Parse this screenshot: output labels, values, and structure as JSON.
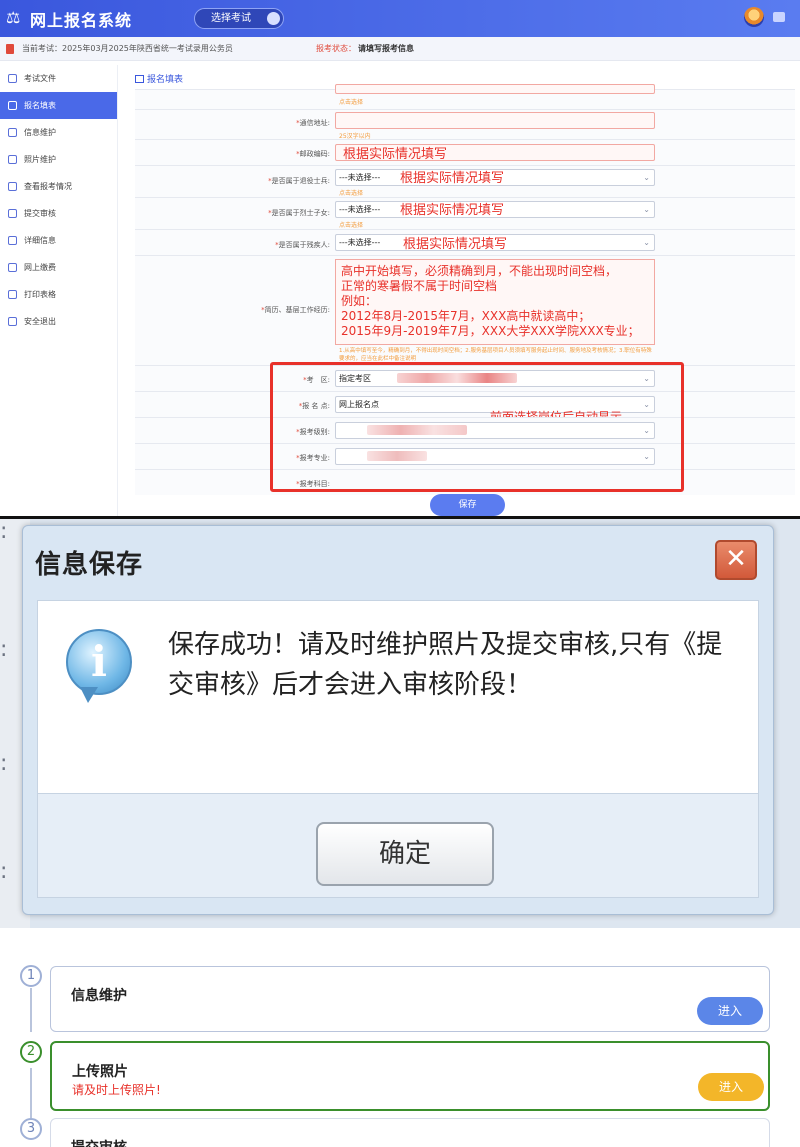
{
  "header": {
    "app_title": "网上报名系统",
    "exam_button": "选择考试",
    "current_exam_label": "当前考试：",
    "current_exam": "2025年03月2025年陕西省统一考试录用公务员",
    "status_label": "报考状态：",
    "status_value": "请填写报考信息"
  },
  "sidebar": {
    "items": [
      {
        "label": "考试文件"
      },
      {
        "label": "报名填表"
      },
      {
        "label": "信息维护"
      },
      {
        "label": "照片维护"
      },
      {
        "label": "查看报考情况"
      },
      {
        "label": "提交审核"
      },
      {
        "label": "详细信息"
      },
      {
        "label": "网上缴费"
      },
      {
        "label": "打印表格"
      },
      {
        "label": "安全退出"
      }
    ]
  },
  "form": {
    "title": "报名填表",
    "click_select_hint": "点击选择",
    "address_label": "通信地址:",
    "address_hint": "25汉字以内",
    "postcode_label": "邮政编码:",
    "veteran_label": "是否属于退役士兵:",
    "martyr_label": "是否属于烈士子女:",
    "disabled_label": "是否属于残疾人:",
    "not_selected": "---未选择---",
    "fill_note": "根据实际情况填写",
    "resume_label": "简历、基层工作经历:",
    "resume_lines": [
      "高中开始填写，必须精确到月，不能出现时间空档，",
      "正常的寒暑假不属于时间空档",
      "例如：",
      "2012年8月-2015年7月，XXX高中就读高中；",
      "2015年9月-2019年7月，XXX大学XXX学院XXX专业；"
    ],
    "resume_tip": "1.从高中填写至今，精确到月，不得出现时间空档；2.服务基层项目人员须填写服务起止时间、服务地及考核情况；3.职位有特殊要求的，应当在此栏中备注说明",
    "exam_area_label": "考　区:",
    "exam_area_value": "指定考区",
    "site_label": "报 名 点:",
    "site_value": "网上报名点",
    "level_label": "报考级别:",
    "major_label": "报考专业:",
    "subject_label": "报考科目:",
    "auto_note": "前面选择岗位后自动显示",
    "save_button": "保存"
  },
  "dialog": {
    "title": "信息保存",
    "message": "保存成功！请及时维护照片及提交审核,只有《提交审核》后才会进入审核阶段！",
    "ok_button": "确定"
  },
  "steps": [
    {
      "num": "1",
      "title": "信息维护",
      "subtitle": "",
      "button": "进入"
    },
    {
      "num": "2",
      "title": "上传照片",
      "subtitle": "请及时上传照片!",
      "button": "进入"
    },
    {
      "num": "3",
      "title": "提交审核",
      "subtitle": "",
      "button": ""
    }
  ],
  "colors": {
    "primary": "#4a69e8",
    "warning_red": "#e8312a",
    "hint_orange": "#f39c3d",
    "step2_border": "#3a8f2c",
    "step2_button": "#f3b629"
  }
}
